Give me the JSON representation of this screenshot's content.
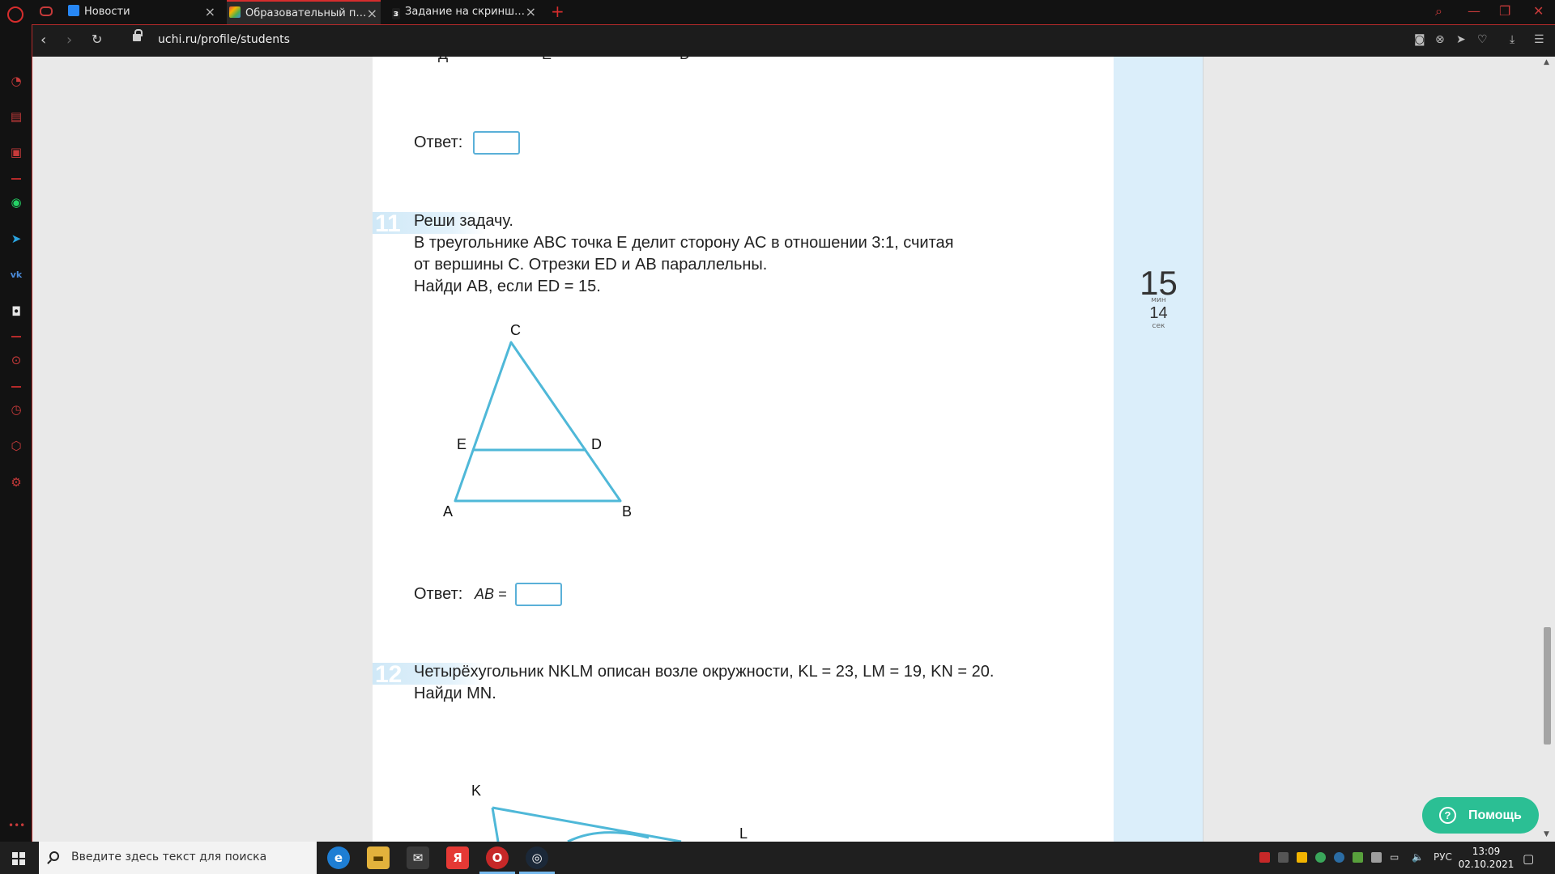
{
  "browser": {
    "tabs": [
      {
        "label": "Новости",
        "favicon": "vk-icon"
      },
      {
        "label": "Образовательный портал",
        "favicon": "uchi-icon",
        "active": true
      },
      {
        "label": "Задание на скриншоте по",
        "favicon": "znanija-icon"
      }
    ],
    "url": "uchi.ru/profile/students"
  },
  "task10": {
    "answer_label": "Ответ:"
  },
  "task11": {
    "number": "11",
    "line1": "Реши задачу.",
    "line2": "В треугольнике ABC точка E делит сторону AC в отношении 3:1, считая",
    "line3": "от вершины C. Отрезки ED и AB параллельны.",
    "line4": "Найди AB, если ED = 15.",
    "answer_label": "Ответ:",
    "answer_var": "AB =",
    "figure": {
      "labels": {
        "C": "C",
        "E": "E",
        "D": "D",
        "A": "A",
        "B": "B"
      },
      "stroke": "#4fb8d8"
    }
  },
  "task12": {
    "number": "12",
    "line1": "Четырёхугольник NKLM описан возле окружности, KL = 23, LM = 19, KN = 20.",
    "line2": "Найди MN.",
    "figure": {
      "labels": {
        "K": "K",
        "L": "L"
      }
    }
  },
  "timer": {
    "minutes": "15",
    "minutes_unit": "мин",
    "seconds": "14",
    "seconds_unit": "сек"
  },
  "help_button": "Помощь",
  "taskbar": {
    "search_placeholder": "Введите здесь текст для поиска",
    "lang": "РУС",
    "time": "13:09",
    "date": "02.10.2021"
  }
}
